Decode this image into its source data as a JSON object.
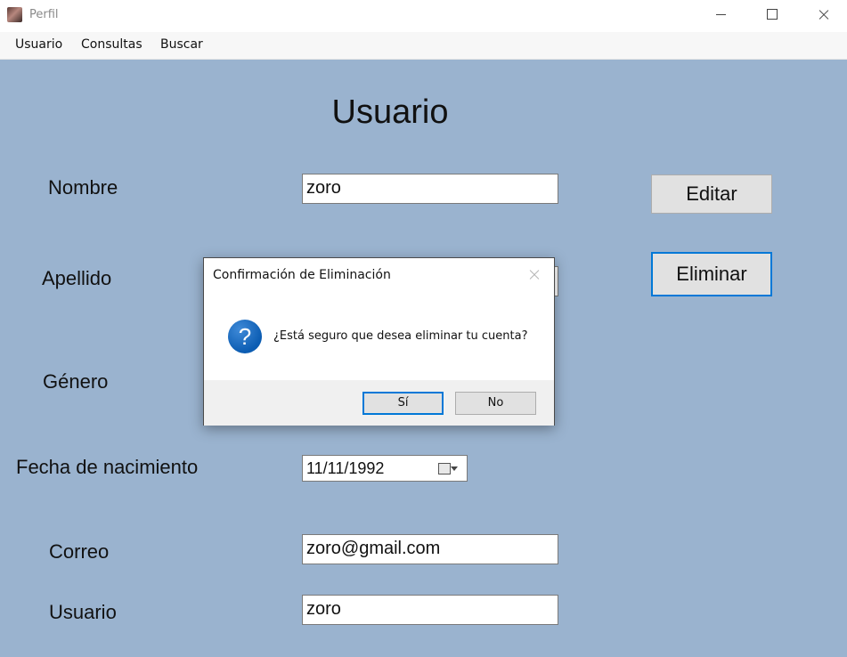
{
  "window": {
    "title": "Perfil"
  },
  "menu": {
    "items": [
      "Usuario",
      "Consultas",
      "Buscar"
    ]
  },
  "form": {
    "heading": "Usuario",
    "labels": {
      "nombre": "Nombre",
      "apellido": "Apellido",
      "genero": "Género",
      "fecha": "Fecha de nacimiento",
      "correo": "Correo",
      "usuario": "Usuario"
    },
    "values": {
      "nombre": "zoro",
      "fecha": "11/11/1992",
      "correo": "zoro@gmail.com",
      "usuario": "zoro"
    },
    "buttons": {
      "editar": "Editar",
      "eliminar": "Eliminar"
    },
    "background_color": "#9ab3cf"
  },
  "dialog": {
    "title": "Confirmación de Eliminación",
    "message": "¿Está seguro que desea eliminar tu cuenta?",
    "icon": "question-icon",
    "yes_label": "Sí",
    "no_label": "No",
    "accent_color": "#0b5cb2"
  }
}
